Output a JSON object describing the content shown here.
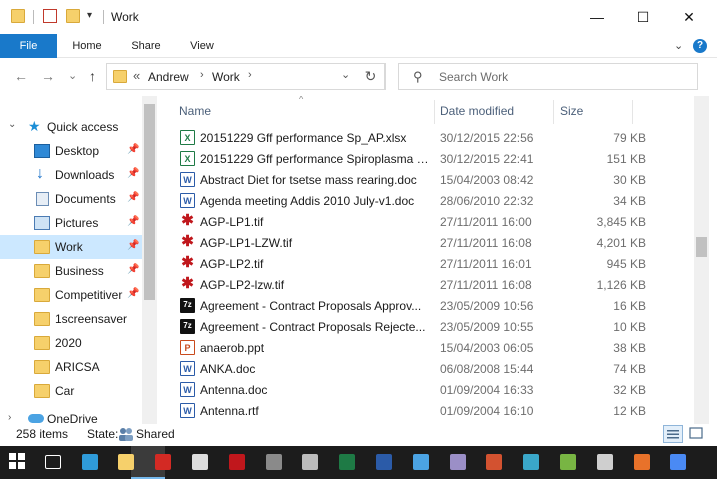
{
  "window": {
    "title": "Work",
    "minimize_glyph": "—",
    "maximize_glyph": "☐",
    "close_glyph": "✕"
  },
  "ribbon": {
    "tabs": [
      "File",
      "Home",
      "Share",
      "View"
    ],
    "expand_glyph": "⌄",
    "help_glyph": "?"
  },
  "navigation": {
    "back_glyph": "←",
    "forward_glyph": "→",
    "recent_glyph": "⌄",
    "up_glyph": "↑"
  },
  "address": {
    "overflow": "«",
    "crumbs": [
      "Andrew",
      "Work"
    ],
    "separator": "›",
    "dropdown_glyph": "⌄",
    "refresh_glyph": "↻"
  },
  "search": {
    "placeholder": "Search Work",
    "icon": "search-icon",
    "glyph": "⚲"
  },
  "nav_pane": {
    "quick_access_label": "Quick access",
    "items": [
      {
        "label": "Desktop",
        "icon": "desktop-icon",
        "pinned": true
      },
      {
        "label": "Downloads",
        "icon": "downloads-icon",
        "pinned": true
      },
      {
        "label": "Documents",
        "icon": "documents-icon",
        "pinned": true
      },
      {
        "label": "Pictures",
        "icon": "pictures-icon",
        "pinned": true
      },
      {
        "label": "Work",
        "icon": "folder-icon",
        "pinned": true,
        "selected": true
      },
      {
        "label": "Business",
        "icon": "folder-icon",
        "pinned": true
      },
      {
        "label": "Competitiver",
        "icon": "folder-icon",
        "pinned": true
      },
      {
        "label": "1screensaver",
        "icon": "folder-icon",
        "pinned": false
      },
      {
        "label": "2020",
        "icon": "folder-icon",
        "pinned": false
      },
      {
        "label": "ARICSA",
        "icon": "folder-icon",
        "pinned": false
      },
      {
        "label": "Car",
        "icon": "folder-icon",
        "pinned": false
      },
      {
        "label": "OneDrive",
        "icon": "onedrive-icon",
        "pinned": false
      }
    ],
    "pin_glyph": "📌"
  },
  "columns": {
    "name": "Name",
    "date": "Date modified",
    "size": "Size",
    "sort_glyph": "^"
  },
  "files": [
    {
      "name": "20151229 Gff performance Sp_AP.xlsx",
      "date": "30/12/2015 22:56",
      "size": "79 KB",
      "type": "xl",
      "glyph": "X"
    },
    {
      "name": "20151229 Gff performance Spiroplasma p...",
      "date": "30/12/2015 22:41",
      "size": "151 KB",
      "type": "xl",
      "glyph": "X"
    },
    {
      "name": "Abstract Diet for tsetse mass rearing.doc",
      "date": "15/04/2003 08:42",
      "size": "30 KB",
      "type": "doc",
      "glyph": "W"
    },
    {
      "name": "Agenda meeting Addis 2010 July-v1.doc",
      "date": "28/06/2010 22:32",
      "size": "34 KB",
      "type": "doc",
      "glyph": "W"
    },
    {
      "name": "AGP-LP1.tif",
      "date": "27/11/2011 16:00",
      "size": "3,845 KB",
      "type": "tif",
      "glyph": "✱"
    },
    {
      "name": "AGP-LP1-LZW.tif",
      "date": "27/11/2011 16:08",
      "size": "4,201 KB",
      "type": "tif",
      "glyph": "✱"
    },
    {
      "name": "AGP-LP2.tif",
      "date": "27/11/2011 16:01",
      "size": "945 KB",
      "type": "tif",
      "glyph": "✱"
    },
    {
      "name": "AGP-LP2-lzw.tif",
      "date": "27/11/2011 16:08",
      "size": "1,126 KB",
      "type": "tif",
      "glyph": "✱"
    },
    {
      "name": "Agreement - Contract Proposals Approv...",
      "date": "23/05/2009 10:56",
      "size": "16 KB",
      "type": "7z",
      "glyph": "7z"
    },
    {
      "name": "Agreement - Contract Proposals Rejecte...",
      "date": "23/05/2009 10:55",
      "size": "10 KB",
      "type": "7z",
      "glyph": "7z"
    },
    {
      "name": "anaerob.ppt",
      "date": "15/04/2003 06:05",
      "size": "38 KB",
      "type": "ppt",
      "glyph": "P"
    },
    {
      "name": "ANKA.doc",
      "date": "06/08/2008 15:44",
      "size": "74 KB",
      "type": "doc",
      "glyph": "W"
    },
    {
      "name": "Antenna.doc",
      "date": "01/09/2004 16:33",
      "size": "32 KB",
      "type": "doc",
      "glyph": "W"
    },
    {
      "name": "Antenna.rtf",
      "date": "01/09/2004 16:10",
      "size": "12 KB",
      "type": "doc",
      "glyph": "W"
    }
  ],
  "status": {
    "item_count": "258 items",
    "state_label": "State:",
    "state_value": "Shared"
  },
  "taskbar": {
    "icons": [
      {
        "name": "start-icon",
        "color": "#ffffff"
      },
      {
        "name": "task-view-icon",
        "color": "#ffffff"
      },
      {
        "name": "edge-icon",
        "color": "#2f9bd9"
      },
      {
        "name": "file-explorer-icon",
        "color": "#f6d06b"
      },
      {
        "name": "acrobat-icon",
        "color": "#d32a24"
      },
      {
        "name": "app-icon",
        "color": "#dddddd"
      },
      {
        "name": "paint-icon",
        "color": "#c0171c"
      },
      {
        "name": "calculator-icon",
        "color": "#8a8a8a"
      },
      {
        "name": "calendar-icon",
        "color": "#bbbbbb"
      },
      {
        "name": "excel-icon",
        "color": "#1e7a45"
      },
      {
        "name": "word-icon",
        "color": "#2b5ba8"
      },
      {
        "name": "onedrive-icon",
        "color": "#4ba3e3"
      },
      {
        "name": "media-player-icon",
        "color": "#9b8fc7"
      },
      {
        "name": "powerpoint-icon",
        "color": "#d35230"
      },
      {
        "name": "photos-icon",
        "color": "#3aa7c9"
      },
      {
        "name": "utorrent-icon",
        "color": "#78b543"
      },
      {
        "name": "bluetooth-icon",
        "color": "#cfcfcf"
      },
      {
        "name": "firefox-icon",
        "color": "#e8722a"
      },
      {
        "name": "chrome-icon",
        "color": "#4a8af4"
      }
    ]
  }
}
